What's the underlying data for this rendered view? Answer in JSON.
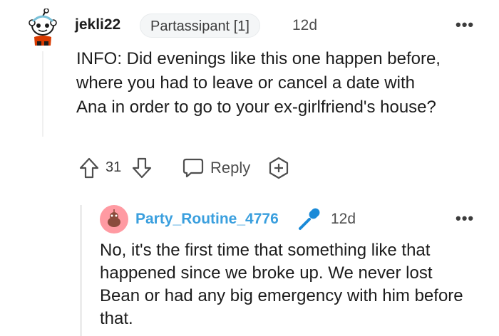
{
  "comment": {
    "username": "jekli22",
    "flair": "Partassipant [1]",
    "age": "12d",
    "more": "•••",
    "body": "INFO: Did evenings like this one happen before, where you had to leave or cancel a date with Ana in order to go to your ex-girlfriend's house?",
    "votes": "31",
    "reply_label": "Reply"
  },
  "reply": {
    "username": "Party_Routine_4776",
    "age": "12d",
    "more": "•••",
    "body": "No, it's the first time that something like that happened since we broke up. We never lost Bean or had any big emergency with him before that."
  },
  "colors": {
    "username_op": "#3a9fde",
    "text": "#1c1c1c",
    "muted": "#4e4e4e",
    "mic_blue": "#1a8ad8"
  }
}
